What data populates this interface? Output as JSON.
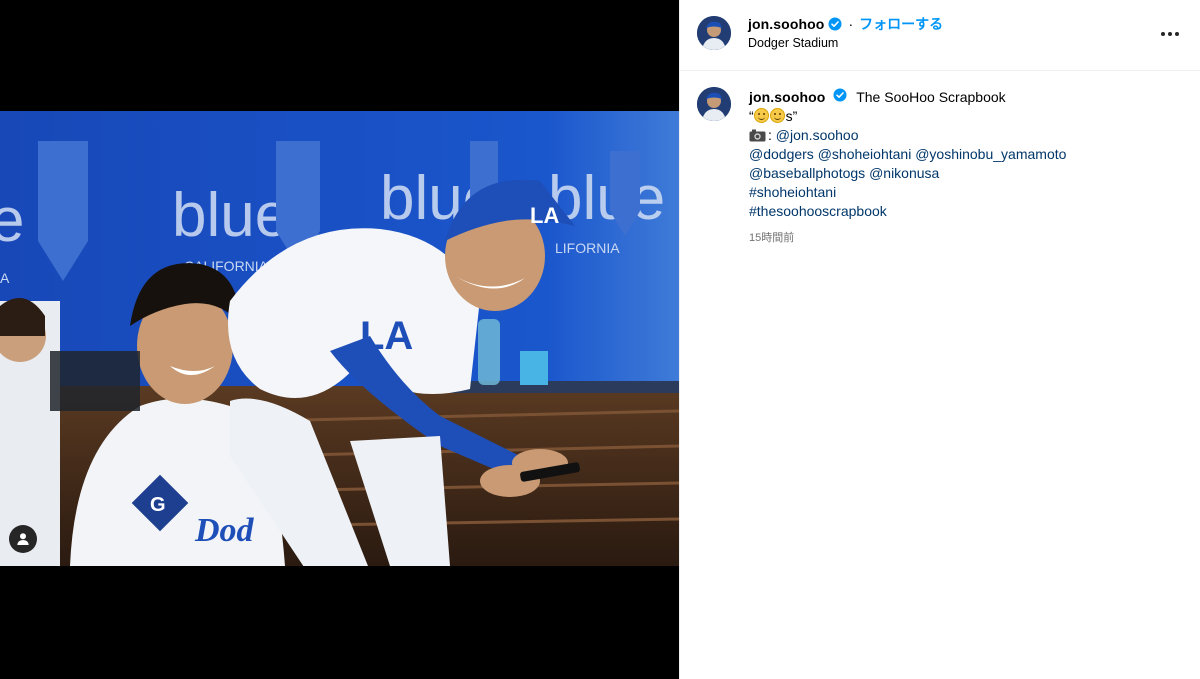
{
  "post": {
    "username": "jon.soohoo",
    "follow_dot": "·",
    "follow_label": "フォローする",
    "location": "Dodger Stadium",
    "more_icon": "more-horizontal-icon"
  },
  "caption": {
    "username": "jon.soohoo",
    "title": "The SooHoo Scrapbook",
    "quote_open": "“",
    "quote_suffix": "s”",
    "photo_credit_prefix": ": ",
    "photo_credit_handle": "@jon.soohoo",
    "mentions_line1": [
      "@dodgers",
      "@shoheiohtani",
      "@yoshinobu_yamamoto"
    ],
    "mentions_line2": [
      "@baseballphotogs",
      "@nikonusa"
    ],
    "hashtags": [
      "#shoheiohtani",
      "#thesoohooscrapbook"
    ],
    "timestamp": "15時間前"
  },
  "colors": {
    "accent_blue": "#0095f6",
    "link_blue": "#00376b",
    "verified_blue": "#0095f6",
    "muted": "#737373",
    "dodger_blue": "#1e4fb8"
  }
}
